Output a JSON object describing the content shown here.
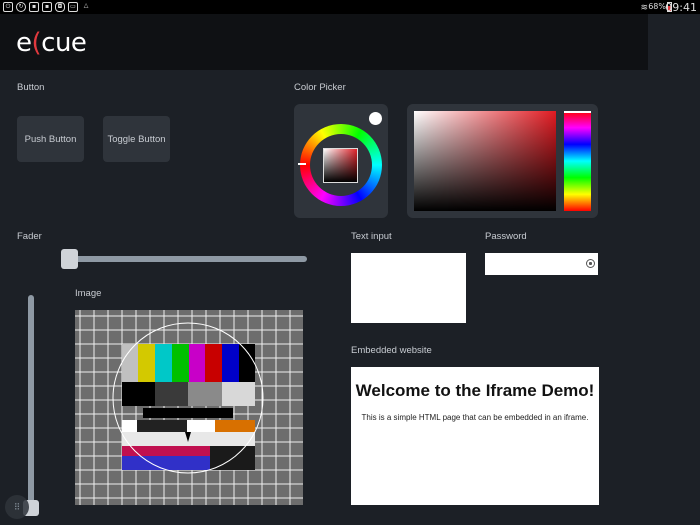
{
  "status_bar": {
    "left_icons": [
      "power-icon",
      "refresh-icon",
      "sb-box-icon",
      "sb-box2-icon",
      "android-icon",
      "tablet-icon",
      "drive-icon"
    ],
    "battery_percent": "68%",
    "time": "09:41"
  },
  "app": {
    "brand_prefix": "e",
    "brand_accent": "(",
    "brand_suffix": "cue",
    "accent_color": "#e0393e"
  },
  "sections": {
    "button": {
      "label": "Button",
      "push_label": "Push Button",
      "toggle_label": "Toggle Button"
    },
    "color_picker": {
      "label": "Color Picker"
    },
    "fader": {
      "label": "Fader",
      "horizontal_level": 0.0,
      "vertical_level": 0.0
    },
    "image": {
      "label": "Image"
    },
    "text_input": {
      "label": "Text input",
      "value": ""
    },
    "password": {
      "label": "Password",
      "value": ""
    },
    "embedded": {
      "label": "Embedded website",
      "title": "Welcome to the Iframe Demo!",
      "text": "This is a simple HTML page that can be embedded in an iframe."
    }
  }
}
